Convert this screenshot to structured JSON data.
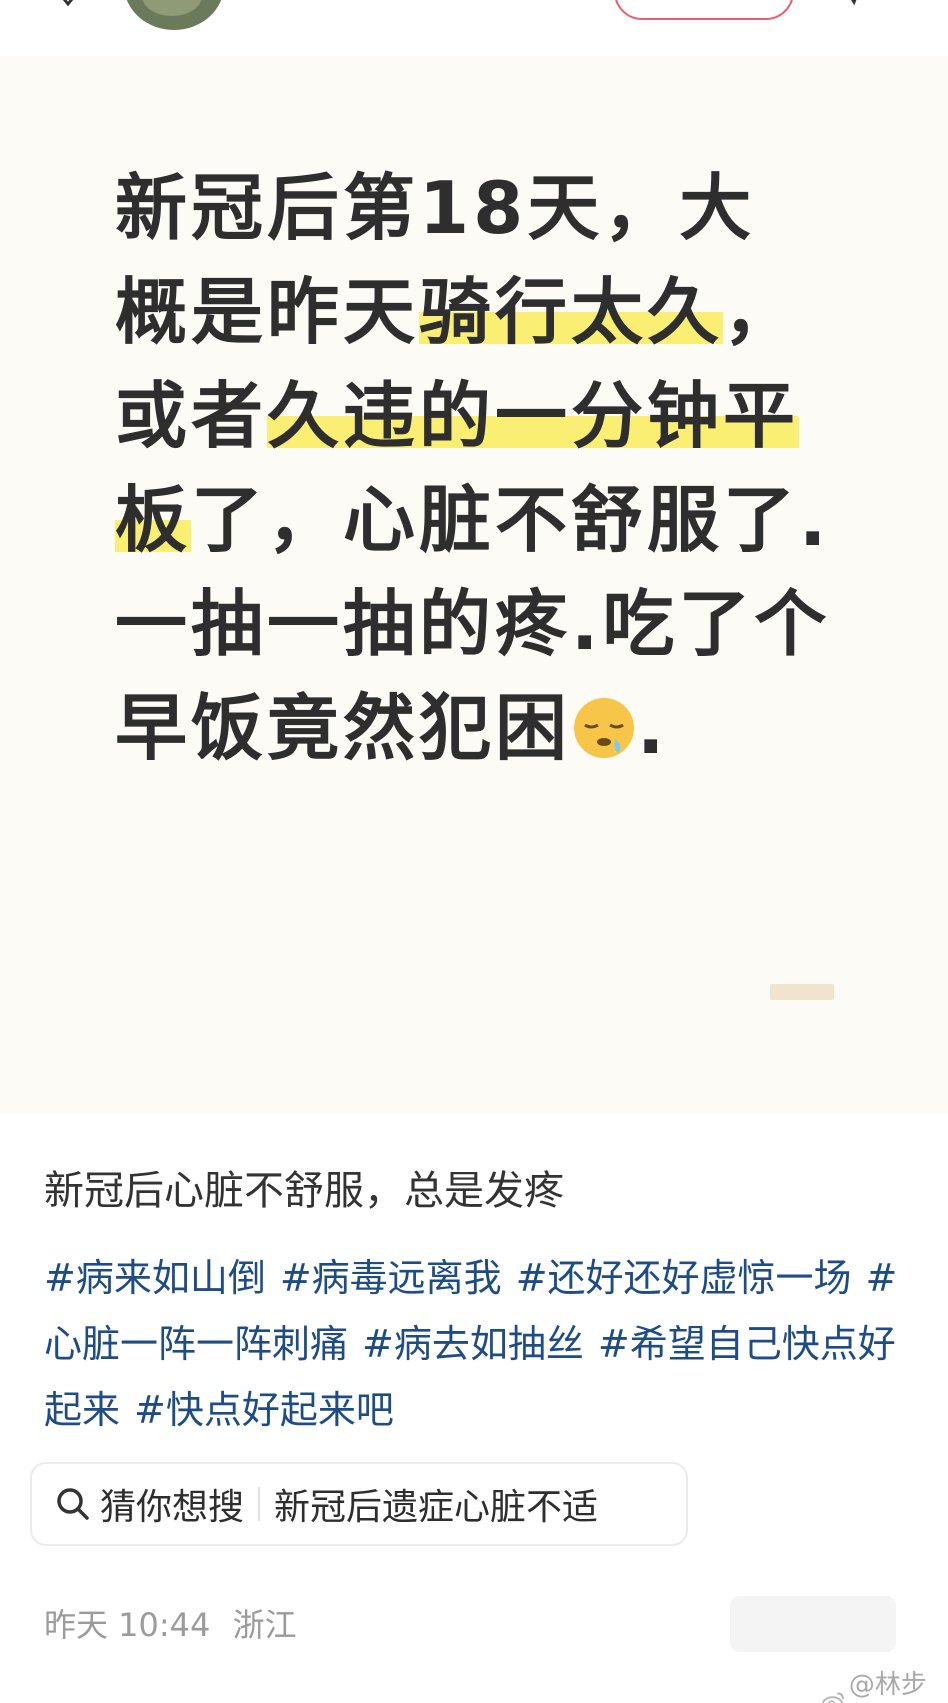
{
  "image_text": {
    "lines": [
      [
        "新冠后第18天，大"
      ],
      [
        "概是昨天",
        {
          "hl": "骑行太久"
        },
        "，"
      ],
      [
        "或者",
        {
          "hl": "久违的一分钟平"
        }
      ],
      [
        {
          "hl": "板"
        },
        "了，心脏不舒服了."
      ],
      [
        "一抽一抽的疼.吃了个"
      ],
      [
        "早饭竟然犯困",
        {
          "emoji": "sleepy-face"
        },
        "."
      ]
    ]
  },
  "post": {
    "title": "新冠后心脏不舒服，总是发疼",
    "tags": [
      "#病来如山倒",
      "#病毒远离我",
      "#还好还好虚惊一场",
      "#心脏一阵一阵刺痛",
      "#病去如抽丝",
      "#希望自己快点好起来",
      "#快点好起来吧"
    ]
  },
  "guess": {
    "label": "猜你想搜",
    "query": "新冠后遗症心脏不适"
  },
  "meta": {
    "time": "昨天 10:44",
    "location": "浙江"
  },
  "watermark": "@林步里",
  "colors": {
    "tag": "#1e4d86",
    "highlight": "#fbef73",
    "card_bg": "#fcfbf6",
    "follow_border": "#f15b6c"
  },
  "icons": [
    "back-icon",
    "share-icon",
    "search-icon",
    "weibo-icon",
    "sleepy-face-emoji"
  ]
}
